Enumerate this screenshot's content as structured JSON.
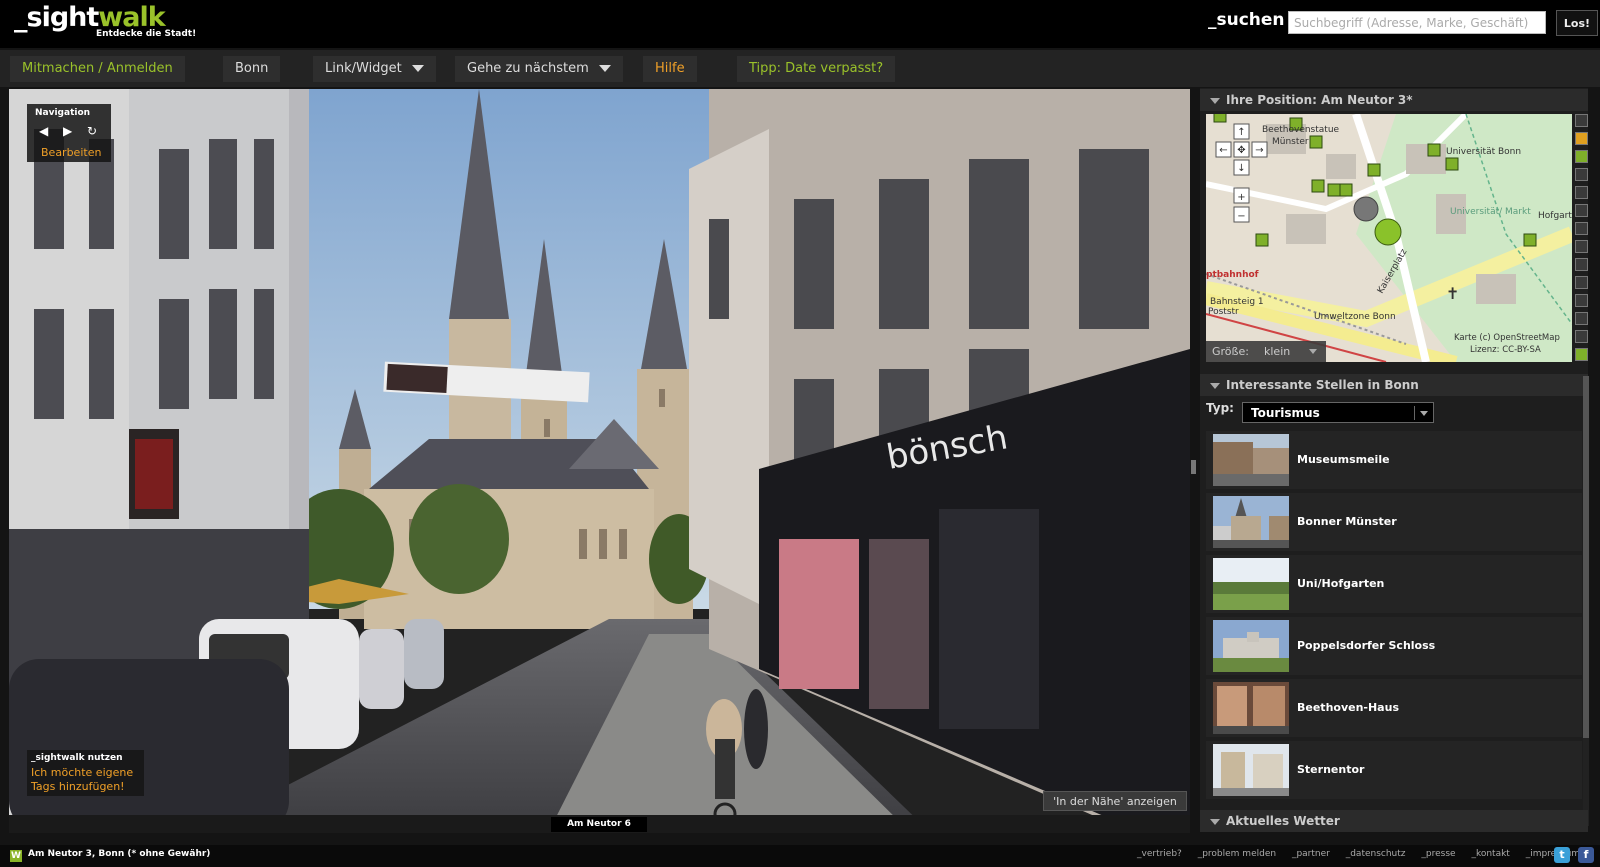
{
  "header": {
    "logo_prefix": "_sight",
    "logo_suffix": "walk",
    "logo_tagline": "Entdecke die Stadt!",
    "search_label": "_suchen",
    "search_placeholder": "Suchbegriff (Adresse, Marke, Geschäft)",
    "search_button": "Los!"
  },
  "nav": {
    "items": [
      {
        "label": "Mitmachen / Anmelden"
      },
      {
        "label": "Bonn"
      },
      {
        "label": "Link/Widget"
      },
      {
        "label": "Gehe zu nächstem"
      },
      {
        "label": "Hilfe"
      },
      {
        "label": "Tipp: Date verpasst?"
      }
    ]
  },
  "viewer": {
    "navigation_title": "Navigation",
    "edit_label": "Bearbeiten",
    "use_title": "_sightwalk nutzen",
    "use_link": "Ich möchte eigene Tags hinzufügen!",
    "nearby_button": "'In der Nähe' anzeigen",
    "street_label": "Am Neutor  6",
    "shop_sign": "bönsch"
  },
  "position_panel": {
    "title": "Ihre Position: Am Neutor  3*",
    "size_label": "Größe:",
    "size_value": "klein",
    "map_labels": {
      "beethoven": "Beethovenstatue",
      "muenster": "Münster",
      "uni": "Universität Bonn",
      "uni_markt": "Universität/ Markt",
      "hofgarten": "Hofgarten",
      "bahnhof": "ptbahnhof",
      "poststr": "Poststr",
      "bahnsteig": "Bahnsteig 1",
      "umweltzone": "Umweltzone Bonn",
      "kaiserplatz": "Kaiserplatz",
      "attribution": "Karte (c) OpenStreetMap",
      "license": "Lizenz: CC-BY-SA"
    }
  },
  "poi_panel": {
    "title": "Interessante Stellen in Bonn",
    "type_label": "Typ:",
    "type_value": "Tourismus",
    "items": [
      {
        "name": "Museumsmeile"
      },
      {
        "name": "Bonner Münster"
      },
      {
        "name": "Uni/Hofgarten"
      },
      {
        "name": "Poppelsdorfer Schloss"
      },
      {
        "name": "Beethoven-Haus"
      },
      {
        "name": "Sternentor"
      }
    ]
  },
  "weather_panel": {
    "title": "Aktuelles Wetter"
  },
  "footer": {
    "location": "Am Neutor  3,   Bonn   (* ohne Gewähr)",
    "links": [
      "_vertrieb?",
      "_problem melden",
      "_partner",
      "_datenschutz",
      "_presse",
      "_kontakt",
      "_impressum"
    ]
  },
  "colors": {
    "accent_green": "#9ac22a",
    "accent_orange": "#f0a028",
    "background": "#141414"
  }
}
